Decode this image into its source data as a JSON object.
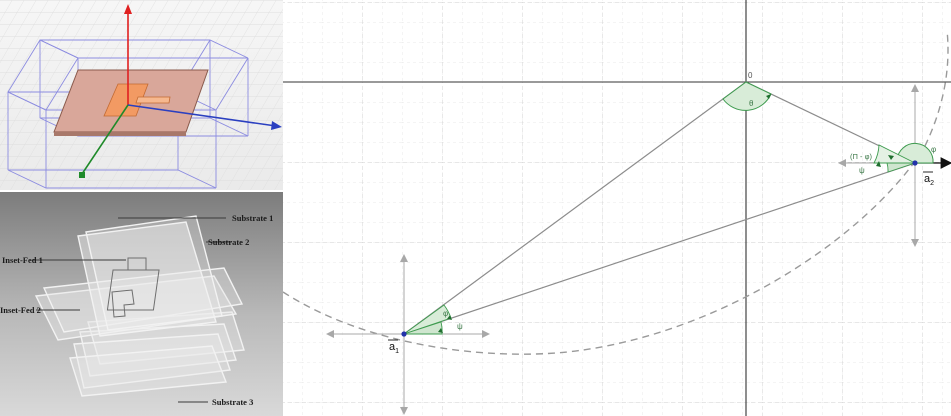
{
  "stack_labels": {
    "substrate1": "Substrate 1",
    "substrate2": "Substrate 2",
    "substrate3": "Substrate 3",
    "inset_fed1": "Inset-Fed 1",
    "inset_fed2": "Inset-Fed 2"
  },
  "geometry": {
    "origin_label": "0",
    "theta": "θ",
    "phi": "φ",
    "psi": "ψ",
    "pi_minus_psi": "(Π - φ)",
    "a1_letter": "a",
    "a1_sub": "1",
    "a2_letter": "a",
    "a2_sub": "2"
  },
  "colors": {
    "patch": "#c98a78",
    "feed": "#f29a63",
    "z_axis": "#e02020",
    "x_axis": "#2a3fc0",
    "y_axis": "#1f8a2a",
    "angle_fill": "#d8ecd8",
    "angle_stroke": "#3e9b4f"
  }
}
